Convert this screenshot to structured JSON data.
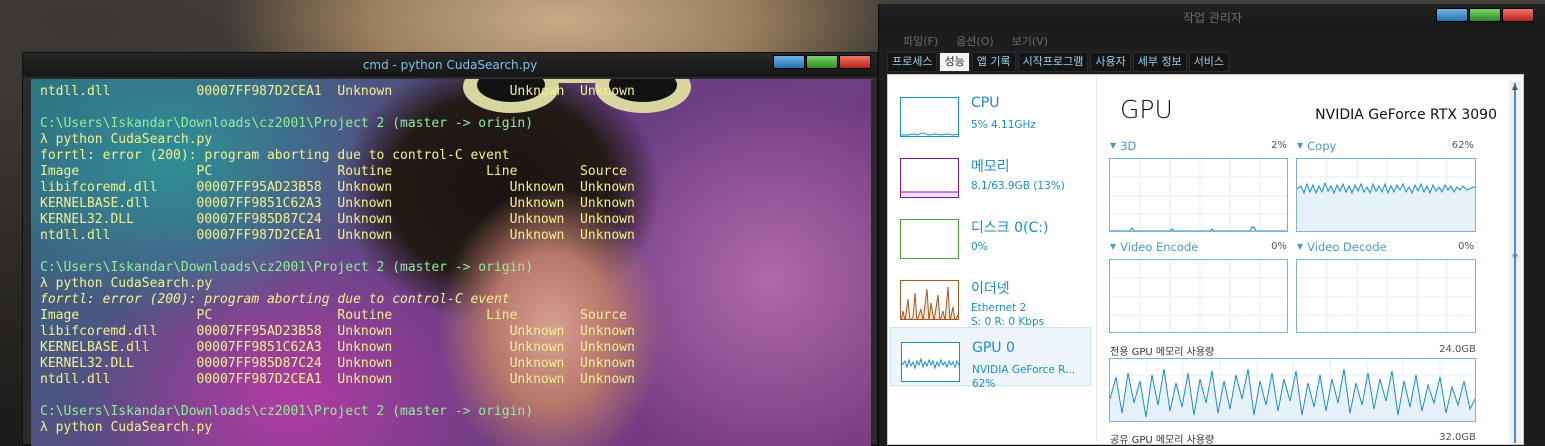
{
  "cmd": {
    "title": "cmd - python  CudaSearch.py",
    "lines": [
      {
        "t": "ntdll.dll           00007FF987D2CEA1  Unknown               Unknown  Unknown",
        "c": ""
      },
      {
        "t": "",
        "c": ""
      },
      {
        "t": "C:\\Users\\Iskandar\\Downloads\\cz2001\\Project 2 (master -> origin)",
        "c": "ln-prompt"
      },
      {
        "t": "λ python CudaSearch.py",
        "c": ""
      },
      {
        "t": "forrtl: error (200): program aborting due to control-C event",
        "c": ""
      },
      {
        "t": "Image               PC                Routine            Line        Source",
        "c": ""
      },
      {
        "t": "libifcoremd.dll     00007FF95AD23B58  Unknown               Unknown  Unknown",
        "c": ""
      },
      {
        "t": "KERNELBASE.dll      00007FF9851C62A3  Unknown               Unknown  Unknown",
        "c": ""
      },
      {
        "t": "KERNEL32.DLL        00007FF985D87C24  Unknown               Unknown  Unknown",
        "c": ""
      },
      {
        "t": "ntdll.dll           00007FF987D2CEA1  Unknown               Unknown  Unknown",
        "c": ""
      },
      {
        "t": "",
        "c": ""
      },
      {
        "t": "C:\\Users\\Iskandar\\Downloads\\cz2001\\Project 2 (master -> origin)",
        "c": "ln-prompt"
      },
      {
        "t": "λ python CudaSearch.py",
        "c": ""
      },
      {
        "t": "forrtl: error (200): program aborting due to control-C event",
        "c": "ln-error"
      },
      {
        "t": "Image               PC                Routine            Line        Source",
        "c": ""
      },
      {
        "t": "libifcoremd.dll     00007FF95AD23B58  Unknown               Unknown  Unknown",
        "c": ""
      },
      {
        "t": "KERNELBASE.dll      00007FF9851C62A3  Unknown               Unknown  Unknown",
        "c": ""
      },
      {
        "t": "KERNEL32.DLL        00007FF985D87C24  Unknown               Unknown  Unknown",
        "c": ""
      },
      {
        "t": "ntdll.dll           00007FF987D2CEA1  Unknown               Unknown  Unknown",
        "c": ""
      },
      {
        "t": "",
        "c": ""
      },
      {
        "t": "C:\\Users\\Iskandar\\Downloads\\cz2001\\Project 2 (master -> origin)",
        "c": "ln-prompt"
      },
      {
        "t": "λ python CudaSearch.py",
        "c": ""
      }
    ]
  },
  "taskmanager": {
    "title": "작업 관리자",
    "menu": [
      "파일(F)",
      "옵션(O)",
      "보기(V)"
    ],
    "tabs": [
      "프로세스",
      "성능",
      "앱 기록",
      "시작프로그램",
      "사용자",
      "세부 정보",
      "서비스"
    ],
    "active_tab": 1,
    "resources": {
      "cpu": {
        "name": "CPU",
        "sub": "5%  4.11GHz",
        "color": "#1b8ec8"
      },
      "memory": {
        "name": "메모리",
        "sub": "8.1/63.9GB (13%)",
        "color": "#8b14a6"
      },
      "disk": {
        "name": "디스크 0(C:)",
        "sub": "0%",
        "color": "#4da832"
      },
      "ethernet": {
        "name": "이더넷",
        "sub": "Ethernet 2",
        "sub2": "S: 0 R: 0 Kbps",
        "color": "#a7581e"
      },
      "gpu": {
        "name": "GPU 0",
        "sub": "NVIDIA GeForce R...",
        "sub2": "62%",
        "color": "#1b8ec8"
      }
    },
    "detail": {
      "title": "GPU",
      "model": "NVIDIA GeForce RTX 3090",
      "engines": [
        {
          "label": "3D",
          "pct": "2%"
        },
        {
          "label": "Copy",
          "pct": "62%"
        },
        {
          "label": "Video Encode",
          "pct": "0%"
        },
        {
          "label": "Video Decode",
          "pct": "0%"
        }
      ],
      "dedicated_label": "전용 GPU 메모리 사용량",
      "dedicated_value": "24.0GB",
      "shared_label": "공유 GPU 메모리 사용량",
      "shared_value": "32.0GB"
    }
  }
}
